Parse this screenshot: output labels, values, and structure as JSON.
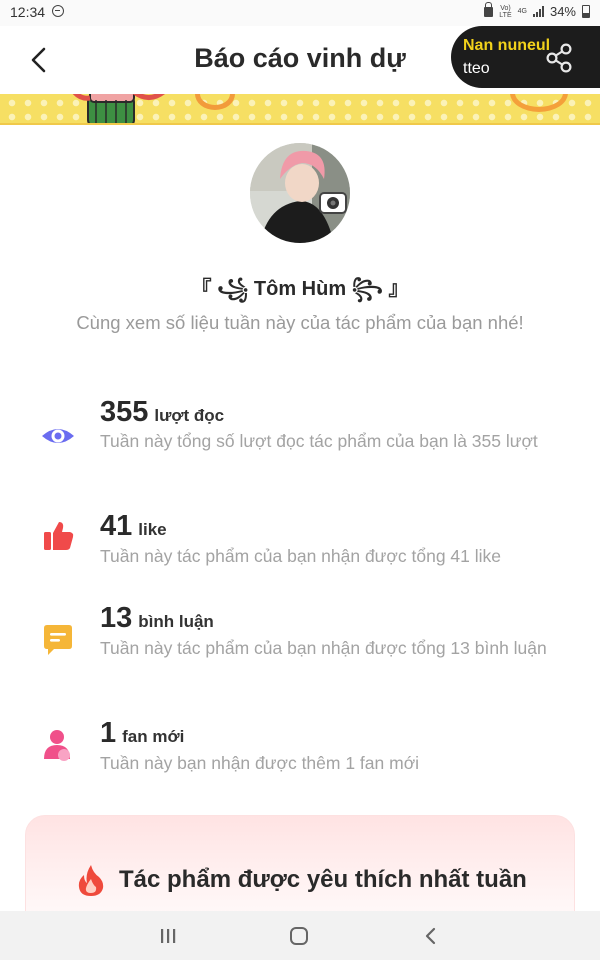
{
  "status_bar": {
    "time": "12:34",
    "network_top": "Vo)",
    "network_bottom": "LTE",
    "network_type": "4G",
    "battery": "34%"
  },
  "header": {
    "title": "Báo cáo vinh dự",
    "pill_name": "Nan nuneul",
    "pill_subtext": "tteo"
  },
  "profile": {
    "name": "『 ꧁ Tôm Hùm ꧂ 』",
    "subtitle": "Cùng xem số liệu tuần này của tác phẩm của bạn nhé!"
  },
  "stats": [
    {
      "icon": "eye-icon",
      "number": "355",
      "unit": "lượt đọc",
      "description": "Tuần này tổng số lượt đọc tác phẩm của bạn là 355 lượt",
      "color": "#6a6cf0"
    },
    {
      "icon": "thumbs-up-icon",
      "number": "41",
      "unit": "like",
      "description": "Tuần này tác phẩm của bạn nhận được tổng 41 like",
      "color": "#f04a4a"
    },
    {
      "icon": "comment-icon",
      "number": "13",
      "unit": "bình luận",
      "description": "Tuần này tác phẩm của bạn nhận được tổng 13 bình luận",
      "color": "#f5b638"
    },
    {
      "icon": "person-icon",
      "number": "1",
      "unit": "fan mới",
      "description": "Tuần này bạn nhận được thêm 1 fan mới",
      "color": "#f0508a"
    }
  ],
  "favorite": {
    "title": "Tác phẩm được yêu thích nhất tuần"
  },
  "colors": {
    "banner": "#f6df63",
    "pill_background": "#1c1c1c",
    "pill_name": "#f2d21b"
  }
}
